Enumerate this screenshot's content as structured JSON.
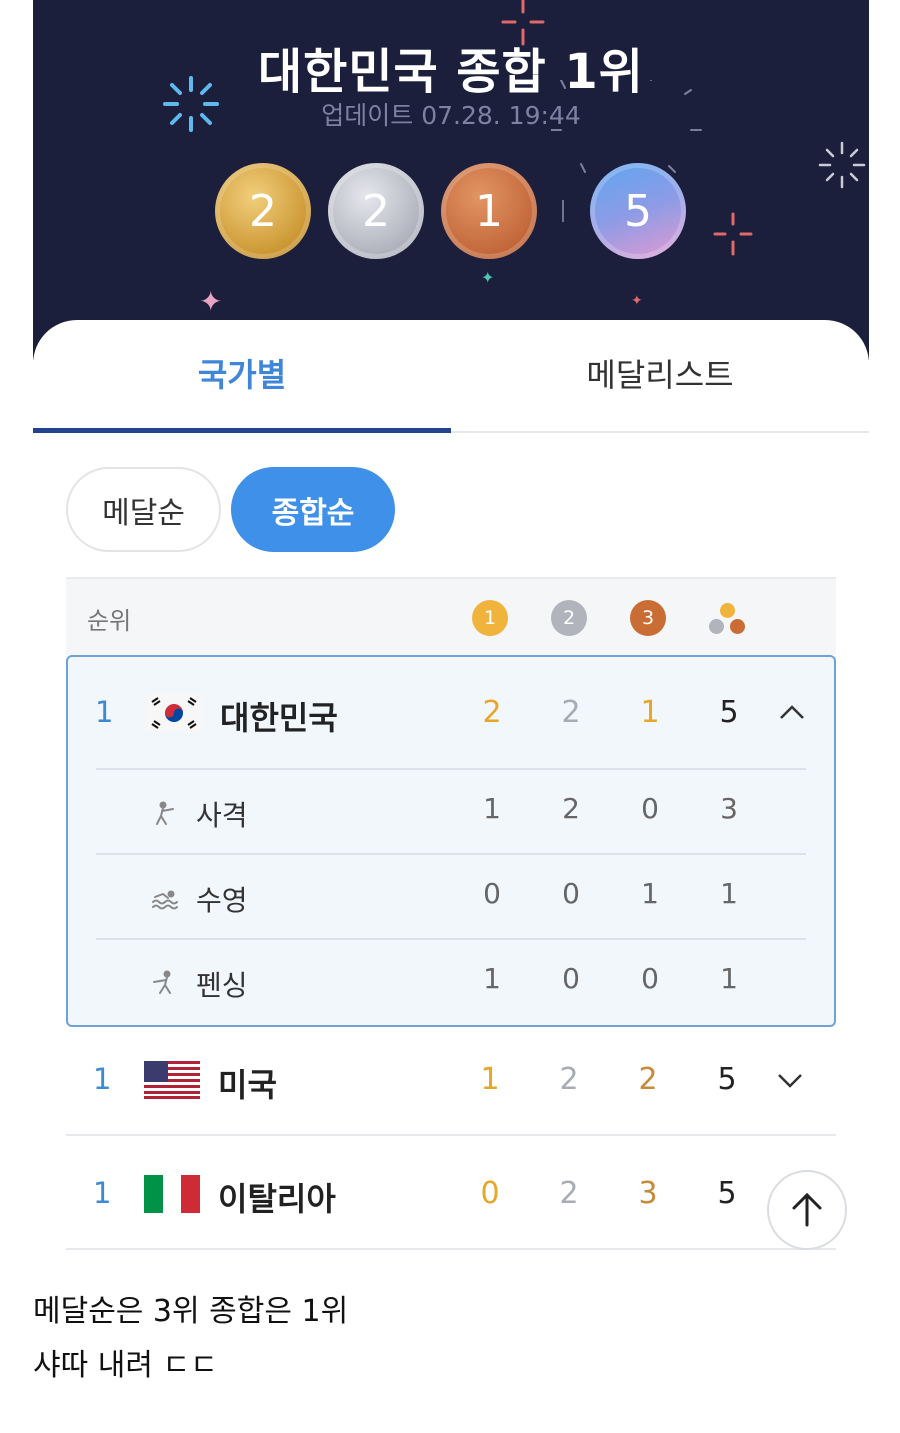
{
  "hero": {
    "title": "대한민국 종합 1위",
    "updated": "업데이트 07.28. 19:44",
    "medals": {
      "gold": "2",
      "silver": "2",
      "bronze": "1",
      "total": "5"
    }
  },
  "tabs": {
    "country": "국가별",
    "medalist": "메달리스트"
  },
  "sort": {
    "medal": "메달순",
    "total": "종합순"
  },
  "table": {
    "rank_header": "순위",
    "header_icons": {
      "gold": "1",
      "silver": "2",
      "bronze": "3"
    },
    "rows": [
      {
        "rank": "1",
        "country": "대한민국",
        "flag": "korea-flag",
        "gold": "2",
        "silver": "2",
        "bronze": "1",
        "total": "5",
        "expanded": true,
        "sports": [
          {
            "name": "사격",
            "icon": "shooting-icon",
            "gold": "1",
            "silver": "2",
            "bronze": "0",
            "total": "3"
          },
          {
            "name": "수영",
            "icon": "swimming-icon",
            "gold": "0",
            "silver": "0",
            "bronze": "1",
            "total": "1"
          },
          {
            "name": "펜싱",
            "icon": "fencing-icon",
            "gold": "1",
            "silver": "0",
            "bronze": "0",
            "total": "1"
          }
        ]
      },
      {
        "rank": "1",
        "country": "미국",
        "flag": "usa-flag",
        "gold": "1",
        "silver": "2",
        "bronze": "2",
        "total": "5",
        "expanded": false
      },
      {
        "rank": "1",
        "country": "이탈리아",
        "flag": "italy-flag",
        "gold": "0",
        "silver": "2",
        "bronze": "3",
        "total": "5",
        "expanded": false
      }
    ]
  },
  "caption": {
    "line1": "메달순은 3위 종합은 1위",
    "line2": "샤따 내려 ㄷㄷ"
  },
  "colors": {
    "accent": "#3e90e8",
    "hero_bg": "#1b1f3c",
    "gold": "#e6a627",
    "silver": "#a8abb3",
    "bronze": "#c56a36",
    "rank": "#3b8ad3"
  }
}
